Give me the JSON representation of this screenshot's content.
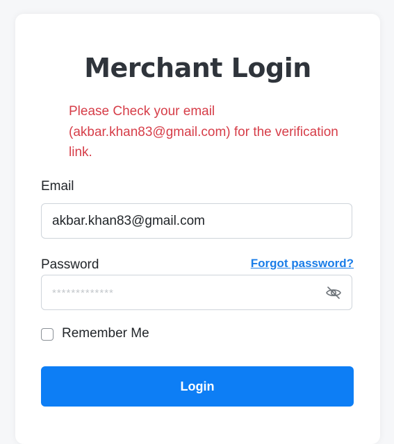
{
  "form": {
    "title": "Merchant Login",
    "alert_message": "Please Check your email (akbar.khan83@gmail.com) for the verification link.",
    "email_label": "Email",
    "email_value": "akbar.khan83@gmail.com",
    "password_label": "Password",
    "forgot_password": "Forgot password?",
    "password_placeholder": "*************",
    "password_icon": "eye-off-icon",
    "remember_label": "Remember Me",
    "remember_checked": false,
    "login_button": "Login"
  },
  "colors": {
    "accent": "#0d7ef5",
    "alert": "#d63d48",
    "link": "#1a7de8"
  }
}
